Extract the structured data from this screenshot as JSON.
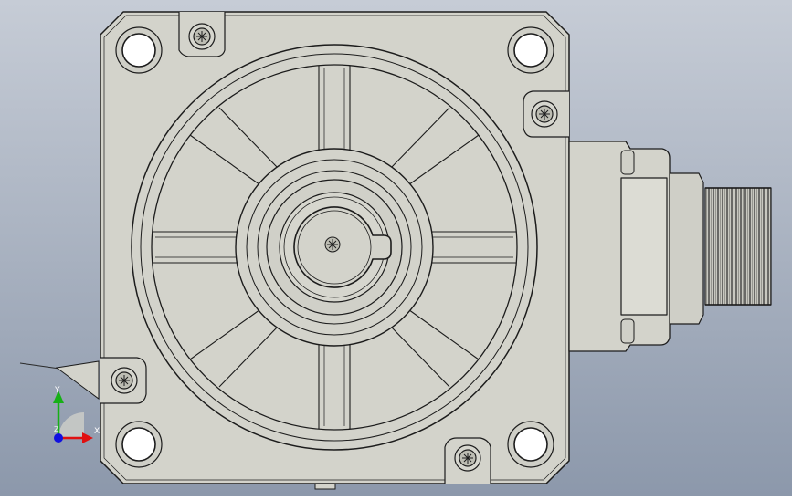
{
  "viewport": {
    "background_top": "#c6ccd6",
    "background_bottom": "#8c98ab",
    "part_fill": "#d3d3cb",
    "part_shade": "#bdbdb3",
    "edge_color": "#1c1c1c"
  },
  "triad": {
    "x_label": "X",
    "y_label": "Y",
    "z_label": "Z",
    "x_color": "#e01010",
    "y_color": "#16b016",
    "z_color": "#1010e0"
  },
  "model": {
    "face_icon": "motor-front-flange",
    "connector_icon": "threaded-connector"
  }
}
